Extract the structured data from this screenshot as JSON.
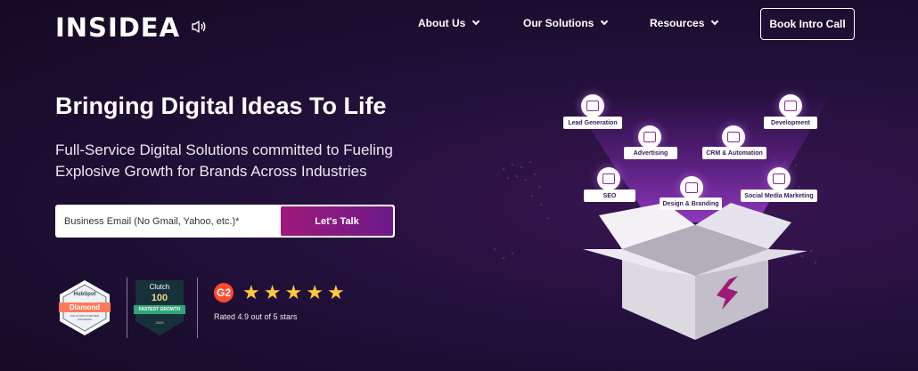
{
  "header": {
    "logo_text": "INSIDEA",
    "nav": [
      {
        "label": "About Us"
      },
      {
        "label": "Our Solutions"
      },
      {
        "label": "Resources"
      }
    ],
    "cta_label": "Book Intro Call"
  },
  "hero": {
    "title": "Bringing Digital Ideas To Life",
    "subtitle": "Full-Service Digital Solutions committed to Fueling Explosive Growth for Brands Across Industries",
    "email_placeholder": "Business Email (No Gmail, Yahoo, etc.)*",
    "submit_label": "Let's Talk"
  },
  "badges": {
    "hubspot": {
      "brand": "HubSpot",
      "tier": "Diamond",
      "caption": "SOLUTIONS PARTNER PROGRAM"
    },
    "clutch": {
      "brand": "Clutch",
      "number": "100",
      "ribbon": "FASTEST GROWTH",
      "year": "2023"
    },
    "g2": {
      "logo": "G2",
      "stars": 5,
      "rating_text": "Rated 4.9 out of 5 stars"
    }
  },
  "illustration": {
    "services": [
      "Lead Generation",
      "Development",
      "Advertising",
      "CRM & Automation",
      "SEO",
      "Design & Branding",
      "Social Media Marketing"
    ],
    "accent": "#a0197a"
  },
  "colors": {
    "background": "#1c0f30",
    "accent_gradient_start": "#a0197a",
    "accent_gradient_end": "#6b1a8a",
    "star": "#ffc83d"
  }
}
